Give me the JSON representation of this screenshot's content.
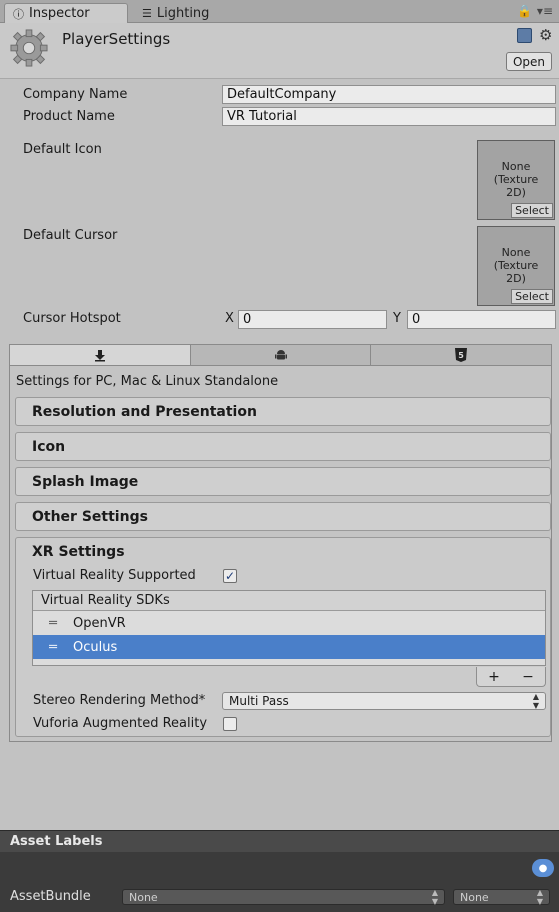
{
  "tabs": [
    {
      "label": "Inspector",
      "icon": "info-icon"
    },
    {
      "label": "Lighting",
      "icon": "lighting-icon"
    }
  ],
  "header": {
    "title": "PlayerSettings",
    "open_label": "Open"
  },
  "fields": {
    "company_name_label": "Company Name",
    "company_name_value": "DefaultCompany",
    "product_name_label": "Product Name",
    "product_name_value": "VR Tutorial",
    "default_icon_label": "Default Icon",
    "default_cursor_label": "Default Cursor",
    "texture_none": "None\n(Texture\n2D)",
    "select_label": "Select",
    "cursor_hotspot_label": "Cursor Hotspot",
    "hotspot_x_label": "X",
    "hotspot_x_value": "0",
    "hotspot_y_label": "Y",
    "hotspot_y_value": "0"
  },
  "platform": {
    "tabs": [
      "standalone-download-icon",
      "android-icon",
      "html5-icon"
    ],
    "active_tab": 0,
    "settings_for": "Settings for PC, Mac & Linux Standalone"
  },
  "sections": [
    "Resolution and Presentation",
    "Icon",
    "Splash Image",
    "Other Settings"
  ],
  "xr": {
    "title": "XR Settings",
    "vr_supported_label": "Virtual Reality Supported",
    "vr_supported_checked": true,
    "sdk_header": "Virtual Reality SDKs",
    "sdks": [
      "OpenVR",
      "Oculus"
    ],
    "selected_sdk": 1,
    "add_label": "+",
    "remove_label": "−",
    "stereo_label": "Stereo Rendering Method*",
    "stereo_value": "Multi Pass",
    "vuforia_label": "Vuforia Augmented Reality",
    "vuforia_checked": false
  },
  "asset": {
    "labels_title": "Asset Labels",
    "assetbundle_label": "AssetBundle",
    "bundle_value": "None",
    "variant_value": "None"
  },
  "colors": {
    "selection": "#4a7fc9",
    "panel": "#c2c2c2",
    "dark_panel": "#3b3b3b"
  }
}
